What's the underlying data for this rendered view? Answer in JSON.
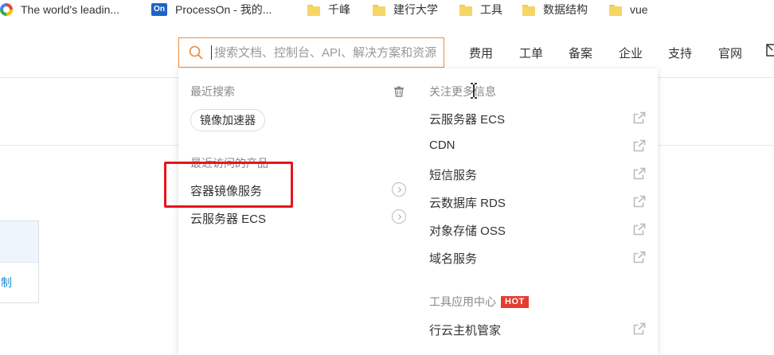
{
  "bookmarks": [
    {
      "label": "The world's leadin...",
      "icon": "google-icon"
    },
    {
      "label": "ProcessOn - 我的...",
      "icon": "processon-icon"
    },
    {
      "label": "千峰",
      "icon": "folder-icon"
    },
    {
      "label": "建行大学",
      "icon": "folder-icon"
    },
    {
      "label": "工具",
      "icon": "folder-icon"
    },
    {
      "label": "数据结构",
      "icon": "folder-icon"
    },
    {
      "label": "vue",
      "icon": "folder-icon"
    }
  ],
  "search": {
    "placeholder": "搜索文档、控制台、API、解决方案和资源",
    "value": ""
  },
  "nav": [
    "费用",
    "工单",
    "备案",
    "企业",
    "支持",
    "官网"
  ],
  "left_panel": {
    "link": "制"
  },
  "dropdown": {
    "recent_search_title": "最近搜索",
    "recent_search_tags": [
      "镜像加速器"
    ],
    "recent_products_title": "最近访问的产品",
    "recent_products": [
      "容器镜像服务",
      "云服务器 ECS"
    ],
    "follow_title": "关注更多信息",
    "follow_items": [
      "云服务器 ECS",
      "CDN",
      "短信服务",
      "云数据库 RDS",
      "对象存储 OSS",
      "域名服务"
    ],
    "tools_title": "工具应用中心",
    "hot_badge": "HOT",
    "tools_items": [
      "行云主机管家"
    ]
  },
  "colors": {
    "accent": "#ef8b3a",
    "highlight": "#e8141c",
    "hot": "#e53d2f",
    "link": "#1e8ad6"
  }
}
